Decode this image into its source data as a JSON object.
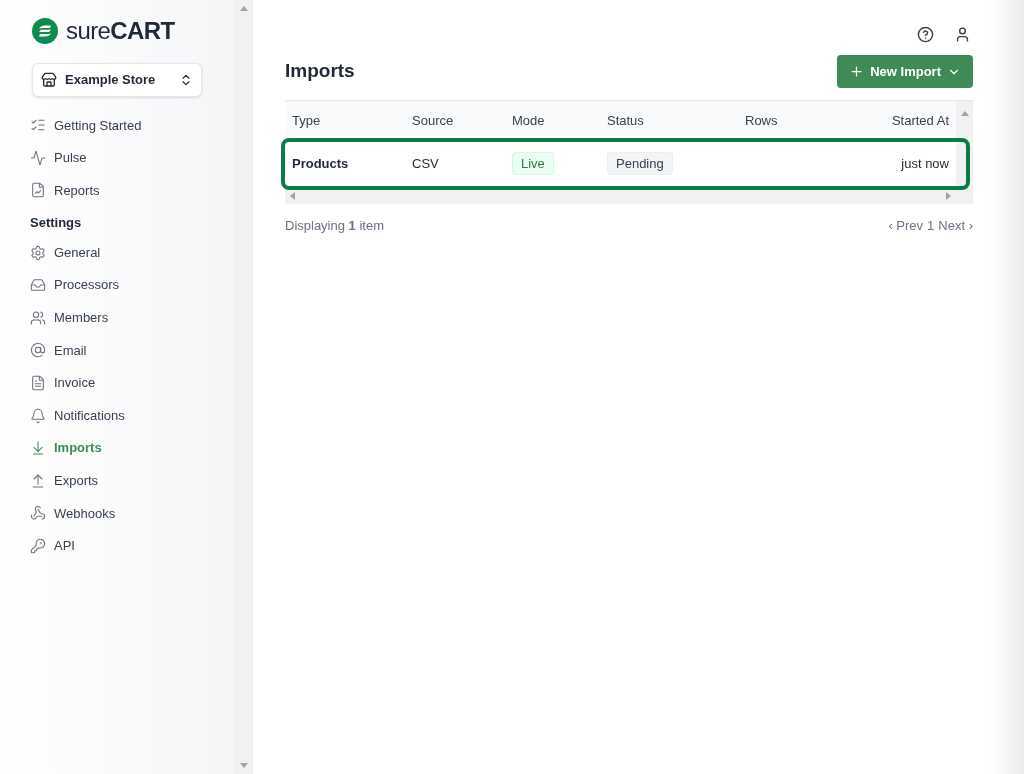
{
  "brand": {
    "logo_text": "sure**CART**"
  },
  "store_switcher": {
    "label": "Example Store"
  },
  "sidebar": {
    "items": [
      {
        "label": "Getting Started",
        "selected": false
      },
      {
        "label": "Pulse",
        "selected": false
      },
      {
        "label": "Reports",
        "selected": false
      }
    ],
    "section_title": "Settings",
    "settings_items": [
      {
        "label": "General",
        "selected": false
      },
      {
        "label": "Processors",
        "selected": false
      },
      {
        "label": "Members",
        "selected": false
      },
      {
        "label": "Email",
        "selected": false
      },
      {
        "label": "Invoice",
        "selected": false
      },
      {
        "label": "Notifications",
        "selected": false
      },
      {
        "label": "Imports",
        "selected": true
      },
      {
        "label": "Exports",
        "selected": false
      },
      {
        "label": "Webhooks",
        "selected": false
      },
      {
        "label": "API",
        "selected": false
      }
    ]
  },
  "page": {
    "title": "Imports",
    "new_button": "New Import"
  },
  "table": {
    "columns": [
      "Type",
      "Source",
      "Mode",
      "Status",
      "Rows",
      "Started At"
    ],
    "rows": [
      {
        "type": "Products",
        "source": "CSV",
        "mode": "Live",
        "status": "Pending",
        "started_at": "just now",
        "highlighted": true
      }
    ]
  },
  "footer": {
    "summary": "Displaying **1** item",
    "prev": "‹ Prev",
    "page": "1",
    "next": "Next ›"
  }
}
